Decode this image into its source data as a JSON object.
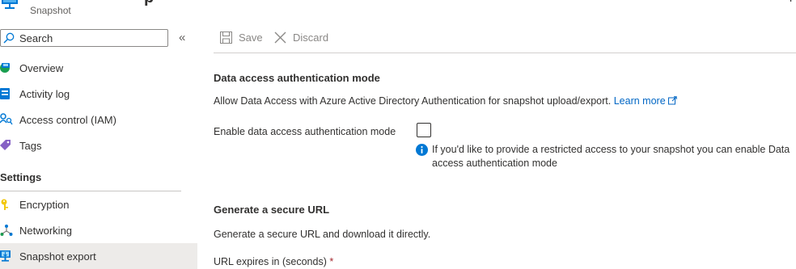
{
  "header": {
    "resource_type": "Snapshot",
    "title_fragment": "p",
    "right_fragment": "p"
  },
  "sidebar": {
    "search_label": "Search",
    "collapse_glyph": "«",
    "items": [
      {
        "label": "Overview",
        "icon": "overview-icon"
      },
      {
        "label": "Activity log",
        "icon": "activity-log-icon"
      },
      {
        "label": "Access control (IAM)",
        "icon": "iam-icon"
      },
      {
        "label": "Tags",
        "icon": "tag-icon"
      }
    ],
    "section_title": "Settings",
    "settings_items": [
      {
        "label": "Encryption",
        "icon": "key-icon"
      },
      {
        "label": "Networking",
        "icon": "networking-icon"
      },
      {
        "label": "Snapshot export",
        "icon": "snapshot-export-icon",
        "active": true
      }
    ]
  },
  "toolbar": {
    "save_label": "Save",
    "discard_label": "Discard"
  },
  "content": {
    "data_access": {
      "title": "Data access authentication mode",
      "description": "Allow Data Access with Azure Active Directory Authentication for snapshot upload/export.",
      "learn_more": "Learn more",
      "checkbox_label": "Enable data access authentication mode",
      "checkbox_checked": false,
      "info_text": "If you'd like to provide a restricted access to your snapshot you can enable Data access authentication mode"
    },
    "secure_url": {
      "title": "Generate a secure URL",
      "description": "Generate a secure URL and download it directly.",
      "expires_label": "URL expires in (seconds)",
      "required_marker": "*"
    }
  },
  "colors": {
    "accent": "#0078d4",
    "link": "#0066c4",
    "required": "#a4262c",
    "active_nav_bg": "#edebe9"
  }
}
